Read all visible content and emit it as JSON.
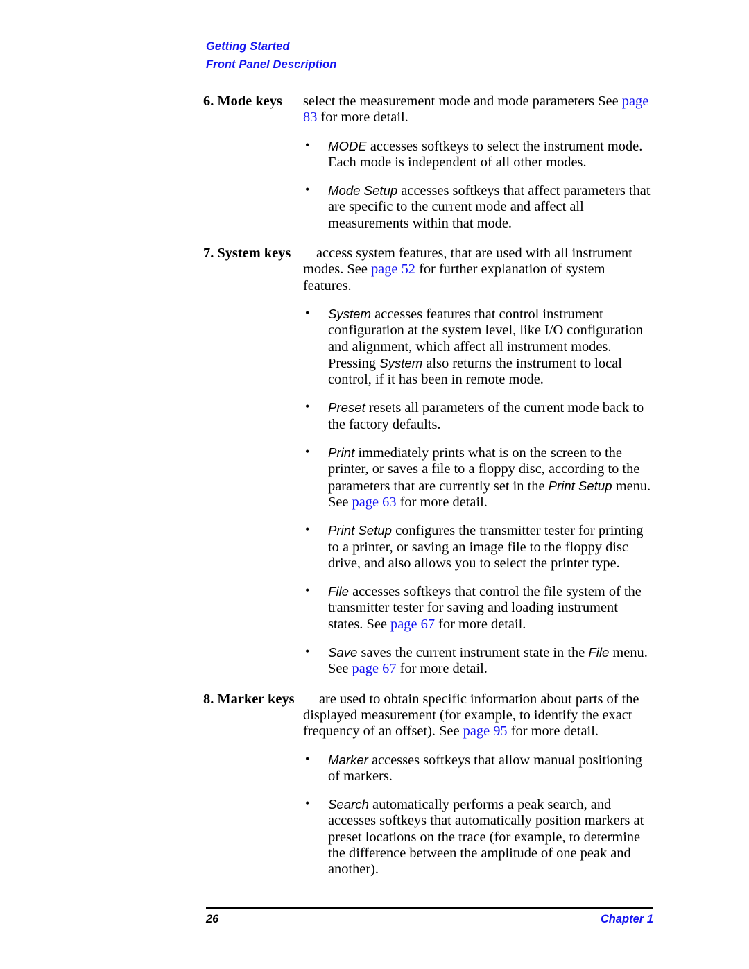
{
  "header": {
    "line1": "Getting Started",
    "line2": "Front Panel Description"
  },
  "colors": {
    "link": "#1414f0",
    "header": "#1414f0",
    "text": "#000000"
  },
  "items": [
    {
      "number": "6.",
      "label": "6. Mode keys",
      "desc_before": "select the measurement mode and mode parameters See ",
      "desc_link": "page 83",
      "desc_after": " for more detail.",
      "bullets": [
        {
          "key": "MODE",
          "text_before": "",
          "text_after": " accesses softkeys to select the instrument mode. Each mode is independent of all other modes.",
          "link": "",
          "tail": ""
        },
        {
          "key": "Mode Setup",
          "text_before": "",
          "text_after": " accesses softkeys that affect parameters that are specific to the current mode and affect all measurements within that mode.",
          "link": "",
          "tail": ""
        }
      ]
    },
    {
      "number": "7.",
      "label": "7. System keys",
      "desc_before": "access system features, that are used with all instrument modes. See ",
      "desc_link": "page 52",
      "desc_after": " for further explanation of system features.",
      "bullets": [
        {
          "key": "System",
          "text_after": " accesses features that control instrument configuration at the system level, like I/O configuration and alignment, which affect all instrument modes. Pressing ",
          "key2": "System",
          "text_after2": " also returns the instrument to local control, if it has been in remote mode."
        },
        {
          "key": "Preset",
          "text_after": " resets all parameters of the current mode back to the factory defaults."
        },
        {
          "key": "Print",
          "text_after": " immediately prints what is on the screen to the printer, or saves a file to a floppy disc, according to the parameters that are currently set in the ",
          "key2": "Print Setup",
          "text_after2": " menu. See ",
          "link": "page 63",
          "tail": " for more detail."
        },
        {
          "key": "Print Setup",
          "text_after": " configures the transmitter tester for printing to a printer, or saving an image file to the floppy disc drive, and also allows you to select the printer type."
        },
        {
          "key": "File",
          "text_after": " accesses softkeys that control the file system of the transmitter tester for saving and loading instrument states. See ",
          "link": "page 67",
          "tail": " for more detail."
        },
        {
          "key": "Save",
          "text_after": " saves the current instrument state in the ",
          "key2": "File",
          "text_after2": " menu. See ",
          "link": "page 67",
          "tail": " for more detail."
        }
      ]
    },
    {
      "number": "8.",
      "label": "8. Marker keys",
      "desc_before": "are used to obtain specific information about parts of the displayed measurement (for example, to identify the exact frequency of an offset). See ",
      "desc_link": "page 95",
      "desc_after": " for more detail.",
      "bullets": [
        {
          "key": "Marker",
          "text_after": " accesses softkeys that allow manual positioning of markers."
        },
        {
          "key": "Search",
          "text_after": " automatically performs a peak search, and accesses softkeys that automatically position markers at preset locations on the trace (for example, to determine the difference between the amplitude of one peak and another)."
        }
      ]
    }
  ],
  "bullet_glyph": "•",
  "footer": {
    "page_number": "26",
    "chapter": "Chapter 1"
  }
}
